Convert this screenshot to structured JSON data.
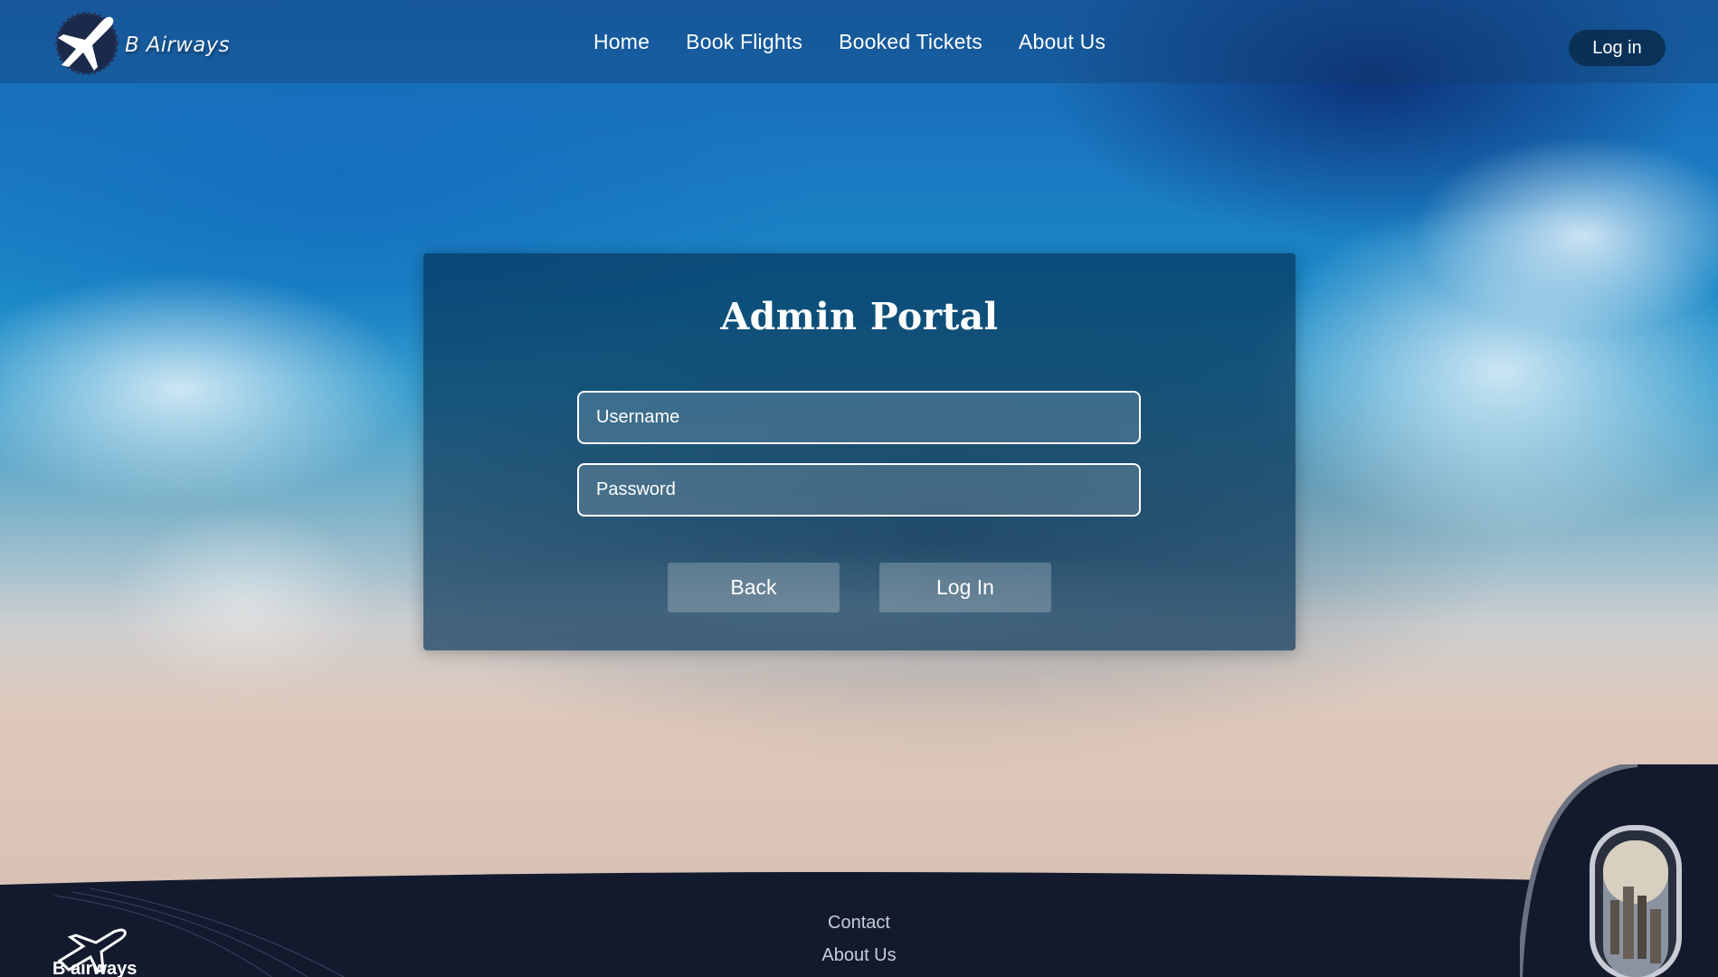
{
  "header": {
    "brand_name": "B Airways",
    "nav": [
      {
        "label": "Home"
      },
      {
        "label": "Book Flights"
      },
      {
        "label": "Booked Tickets"
      },
      {
        "label": "About Us"
      }
    ],
    "login_button": "Log in"
  },
  "login_card": {
    "title": "Admin Portal",
    "username_placeholder": "Username",
    "password_placeholder": "Password",
    "back_button": "Back",
    "login_button": "Log In"
  },
  "footer": {
    "links": [
      {
        "label": "Contact"
      },
      {
        "label": "About Us"
      }
    ],
    "logo_text": "B airways"
  },
  "colors": {
    "navbar_bg": "#143c6e",
    "card_bg": "#043255",
    "footer_bg": "#131a2e",
    "text": "#ffffff"
  },
  "icons": {
    "brand_logo": "airplane-badge-icon",
    "footer_logo": "airplane-icon",
    "corner_art": "airplane-window-icon"
  }
}
